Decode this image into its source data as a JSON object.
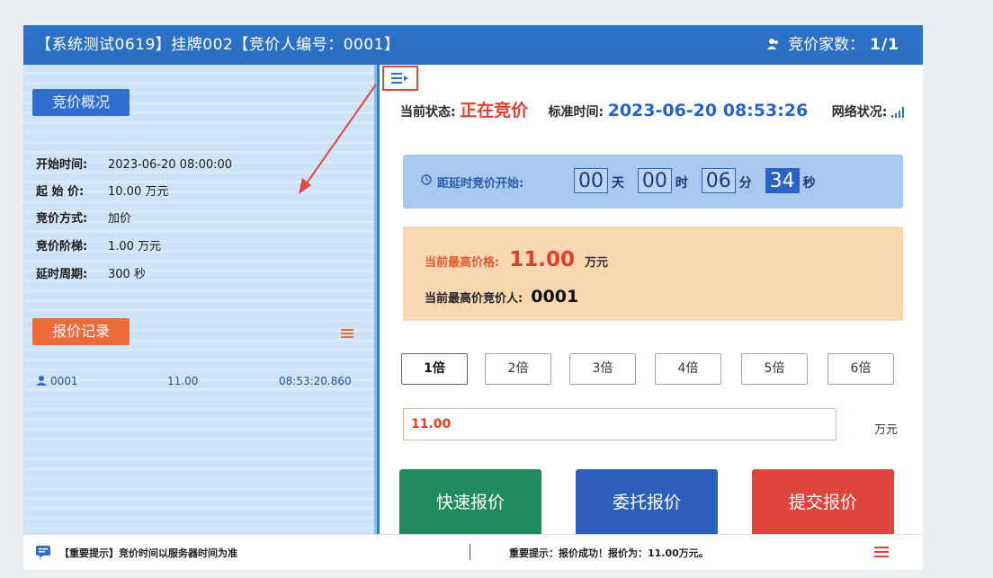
{
  "header": {
    "title": "【系统测试0619】挂牌002【竞价人编号：0001】",
    "bidders_label": "竞价家数：",
    "bidders_value": "1/1"
  },
  "left": {
    "overview_tab": "竞价概况",
    "info": [
      {
        "label": "开始时间:",
        "value": "2023-06-20 08:00:00"
      },
      {
        "label": "起 始 价:",
        "value": "10.00 万元"
      },
      {
        "label": "竞价方式:",
        "value": "加价"
      },
      {
        "label": "竞价阶梯:",
        "value": "1.00 万元"
      },
      {
        "label": "延时周期:",
        "value": "300 秒"
      }
    ],
    "records_tab": "报价记录",
    "records": [
      {
        "bidder": "0001",
        "price": "11.00",
        "time": "08:53:20.860"
      }
    ]
  },
  "status": {
    "state_label": "当前状态:",
    "state_value": "正在竞价",
    "time_label": "标准时间:",
    "time_value": "2023-06-20 08:53:26",
    "network_label": "网络状况:"
  },
  "countdown": {
    "label": "距延时竞价开始:",
    "days": "00",
    "days_unit": "天",
    "hours": "00",
    "hours_unit": "时",
    "minutes": "06",
    "minutes_unit": "分",
    "seconds": "34",
    "seconds_unit": "秒"
  },
  "highest": {
    "price_label": "当前最高价格:",
    "price_value": "11.00",
    "price_unit": "万元",
    "bidder_label": "当前最高价竞价人:",
    "bidder_value": "0001"
  },
  "multipliers": [
    "1倍",
    "2倍",
    "3倍",
    "4倍",
    "5倍",
    "6倍"
  ],
  "bid_input": {
    "value": "11.00",
    "unit": "万元"
  },
  "buttons": {
    "quick": "快速报价",
    "entrust": "委托报价",
    "submit": "提交报价"
  },
  "bottom": {
    "notice": "【重要提示】竞价时间以服务器时间为准",
    "result": "重要提示：报价成功！报价为：11.00万元。"
  },
  "colors": {
    "title_bar": "#2d73c8",
    "status_red": "#e2402c",
    "status_blue": "#2962c7",
    "btn_green": "#1f8a5c",
    "btn_blue": "#2b5fba",
    "btn_red": "#e0453d"
  }
}
